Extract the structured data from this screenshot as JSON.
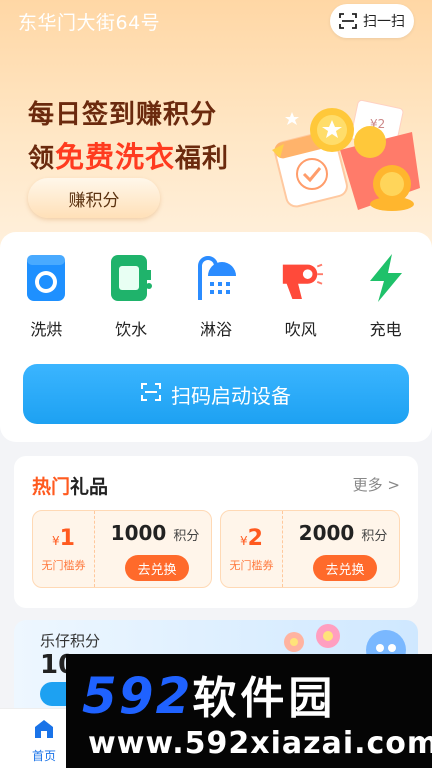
{
  "header": {
    "location": "东华门大街64号",
    "scan_label": "扫一扫"
  },
  "banner": {
    "line1": "每日签到赚积分",
    "line2_prefix": "领",
    "line2_highlight": "免费洗衣",
    "line2_suffix": "福利",
    "button_label": "赚积分",
    "illustration_tag": "¥2"
  },
  "categories": [
    {
      "label": "洗烘",
      "icon": "washing-machine-icon",
      "color": "#1e90ff"
    },
    {
      "label": "饮水",
      "icon": "water-dispenser-icon",
      "color": "#1fb36b"
    },
    {
      "label": "淋浴",
      "icon": "shower-icon",
      "color": "#2b8cff"
    },
    {
      "label": "吹风",
      "icon": "hair-dryer-icon",
      "color": "#ff4a3a"
    },
    {
      "label": "充电",
      "icon": "lightning-icon",
      "color": "#1fc16a"
    }
  ],
  "scan_button": {
    "label": "扫码启动设备"
  },
  "gifts": {
    "title_part1": "热门",
    "title_part2": "礼品",
    "more_label": "更多 >",
    "coupons": [
      {
        "symbol": "¥",
        "amount": "1",
        "condition": "无门槛券",
        "points": "1000",
        "points_unit": "积分",
        "button": "去兑换"
      },
      {
        "symbol": "¥",
        "amount": "2",
        "condition": "无门槛券",
        "points": "2000",
        "points_unit": "积分",
        "button": "去兑换"
      }
    ]
  },
  "points_card": {
    "title": "乐仔积分",
    "value": "10"
  },
  "bottom_nav": {
    "home_label": "首页"
  },
  "watermark": {
    "logo_digits": "592",
    "logo_text": "软件园",
    "url": "www.592xiazai.com"
  },
  "colors": {
    "accent_blue": "#1da1f2",
    "accent_orange": "#ff5a1f"
  }
}
